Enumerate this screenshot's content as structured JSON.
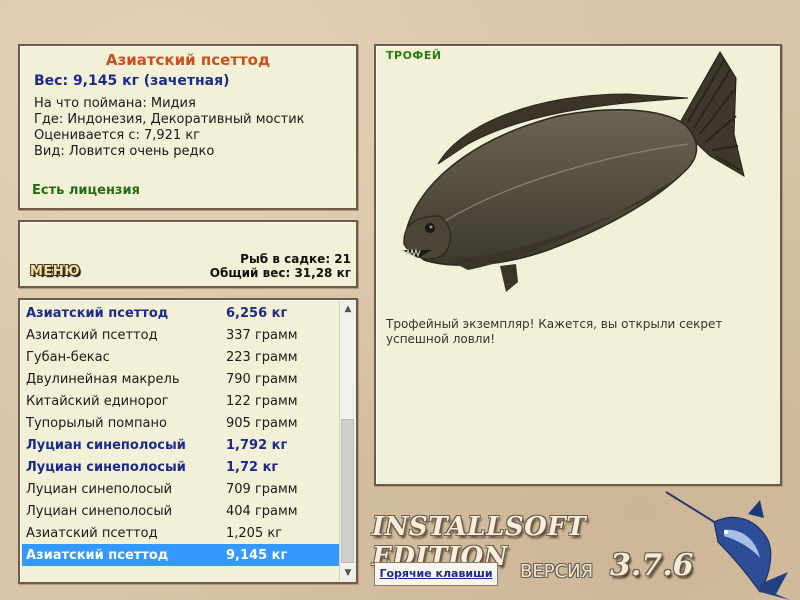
{
  "info": {
    "title": "Азиатский псеттод",
    "weight": "Вес: 9,145 кг (зачетная)",
    "bait": "На что поймана: Мидия",
    "location": "Где: Индонезия, Декоративный мостик",
    "valuation": "Оценивается с: 7,921 кг",
    "rarity": "Вид: Ловится очень редко",
    "license": "Есть лицензия"
  },
  "menu": {
    "button_label": "МЕНЮ",
    "fish_in_keepnet": "Рыб в садке: 21",
    "total_weight": "Общий вес: 31,28 кг"
  },
  "catch_list": [
    {
      "name": "Азиатский псеттод",
      "weight": "6,256 кг",
      "trophy": true,
      "selected": false
    },
    {
      "name": "Азиатский псеттод",
      "weight": "337 грамм",
      "trophy": false,
      "selected": false
    },
    {
      "name": "Губан-бекас",
      "weight": "223 грамм",
      "trophy": false,
      "selected": false
    },
    {
      "name": "Двулинейная макрель",
      "weight": "790 грамм",
      "trophy": false,
      "selected": false
    },
    {
      "name": "Китайский единорог",
      "weight": "122 грамм",
      "trophy": false,
      "selected": false
    },
    {
      "name": "Тупорылый помпано",
      "weight": "905 грамм",
      "trophy": false,
      "selected": false
    },
    {
      "name": "Луциан синеполосый",
      "weight": "1,792 кг",
      "trophy": true,
      "selected": false
    },
    {
      "name": "Луциан синеполосый",
      "weight": "1,72 кг",
      "trophy": true,
      "selected": false
    },
    {
      "name": "Луциан синеполосый",
      "weight": "709 грамм",
      "trophy": false,
      "selected": false
    },
    {
      "name": "Луциан синеполосый",
      "weight": "404 грамм",
      "trophy": false,
      "selected": false
    },
    {
      "name": "Азиатский псеттод",
      "weight": "1,205 кг",
      "trophy": false,
      "selected": false
    },
    {
      "name": "Азиатский псеттод",
      "weight": "9,145 кг",
      "trophy": true,
      "selected": true
    }
  ],
  "trophy": {
    "label": "ТРОФЕЙ",
    "text": "Трофейный экземпляр! Кажется, вы открыли секрет успешной ловли!"
  },
  "footer": {
    "brand": "INSTALLSOFT EDITION",
    "hotkeys": "Горячие клавиши",
    "version_label": "ВЕРСИЯ",
    "version_number": "3.7.6"
  },
  "icons": {
    "scroll_up": "scroll-up-arrow",
    "scroll_down": "scroll-down-arrow",
    "fish_image": "flatfish-photo",
    "logo": "marlin-logo"
  },
  "colors": {
    "panel_bg": "#f2f1d7",
    "title": "#c8501c",
    "trophy_text": "#1c2a8c",
    "license": "#2a6a14",
    "selection": "#3399ff"
  }
}
